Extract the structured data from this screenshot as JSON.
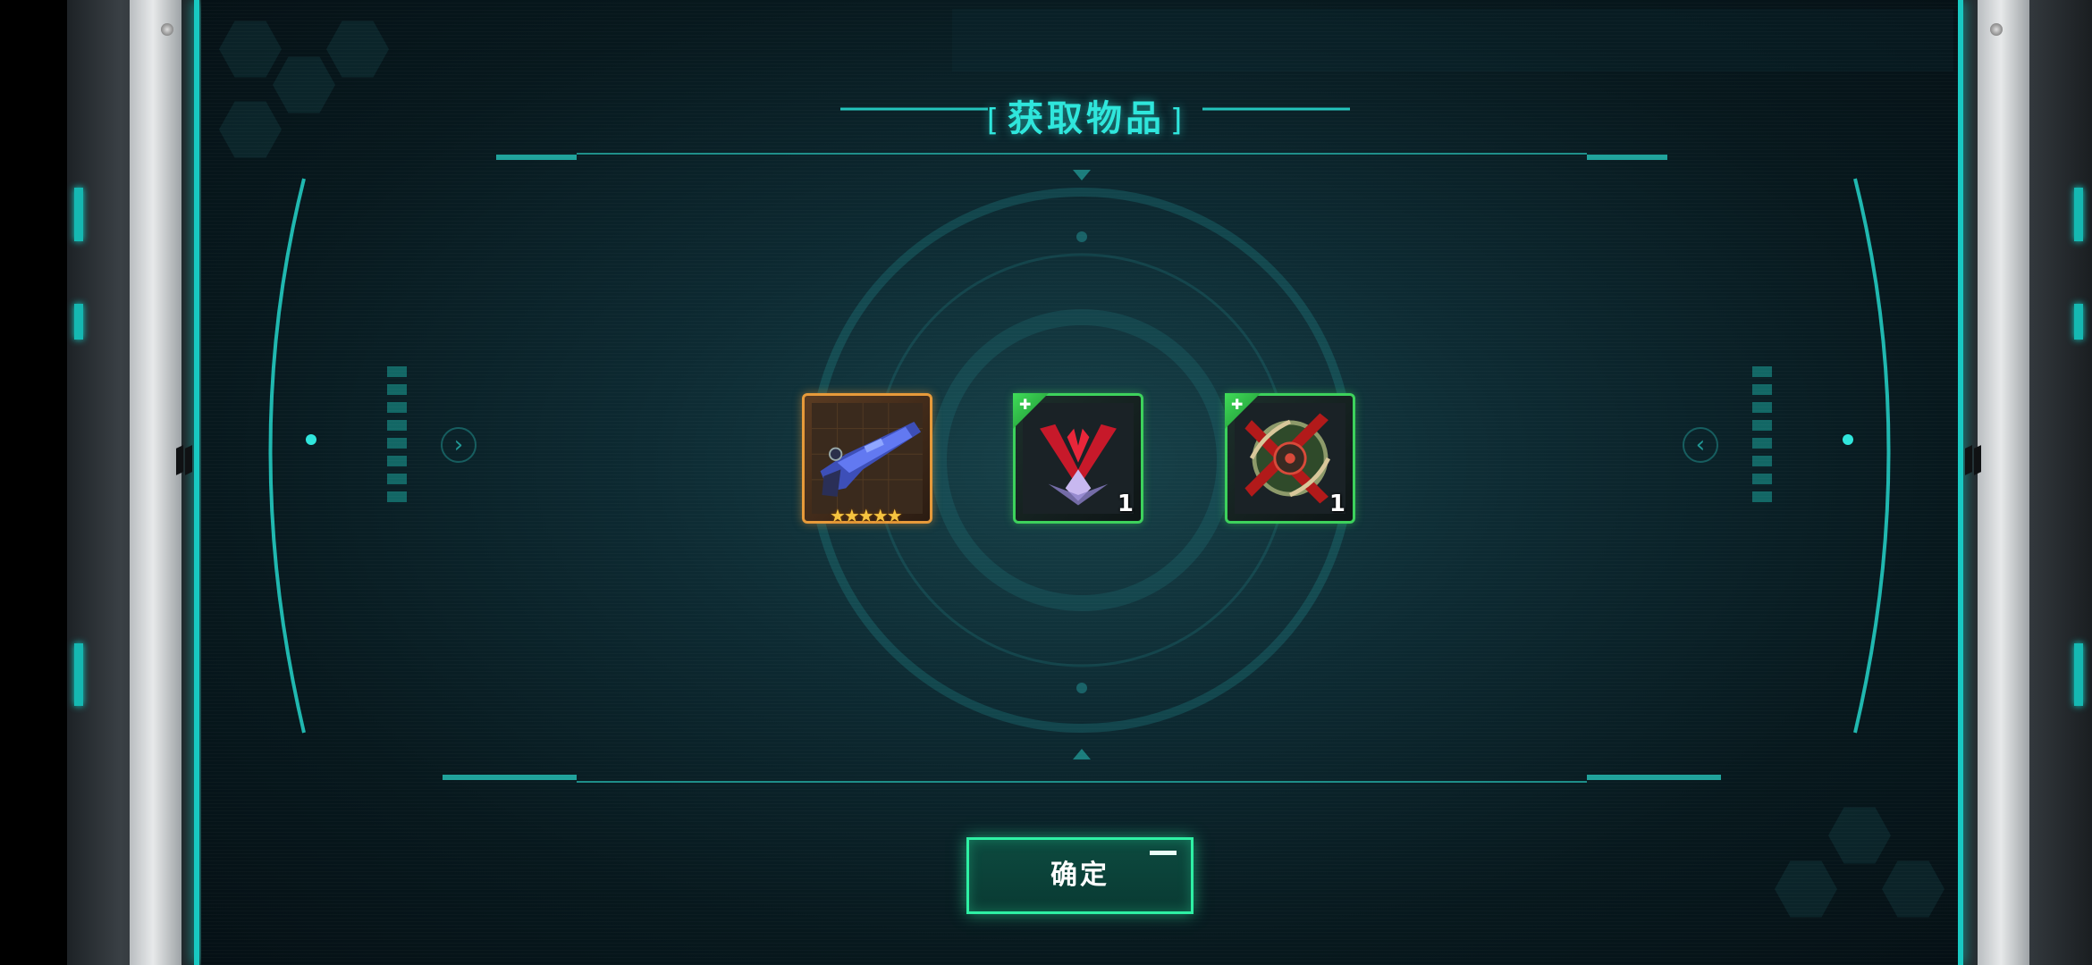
{
  "dialog": {
    "title": "获取物品",
    "bracket_left": "[",
    "bracket_right": "]",
    "confirm_label": "确定"
  },
  "nav": {
    "left_arrow": "›",
    "right_arrow": "‹"
  },
  "items": [
    {
      "name": "rifle",
      "rarity_color": "#e79a3a",
      "stars": "★★★★★",
      "count": ""
    },
    {
      "name": "emblem-v",
      "rarity_color": "#3dd25c",
      "badge": "✚",
      "count": "1"
    },
    {
      "name": "emblem-cross",
      "rarity_color": "#3dd25c",
      "badge": "✚",
      "count": "1"
    }
  ],
  "colors": {
    "accent": "#2fe6dc",
    "confirm_border": "#2ef0a4",
    "gold": "#e79a3a",
    "green": "#3dd25c"
  }
}
